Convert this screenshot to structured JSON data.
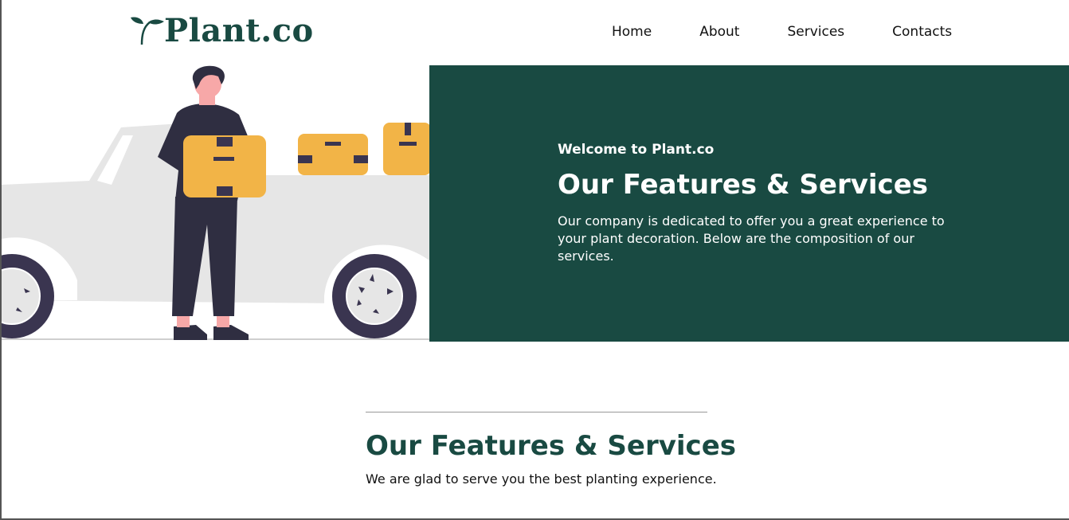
{
  "brand": {
    "name": "Plant.co",
    "color": "#194a42"
  },
  "nav": {
    "items": [
      {
        "label": "Home"
      },
      {
        "label": "About"
      },
      {
        "label": "Services"
      },
      {
        "label": "Contacts"
      }
    ]
  },
  "hero": {
    "kicker": "Welcome to Plant.co",
    "title": "Our Features & Services",
    "description": "Our company is dedicated to offer you a great experience to your plant decoration. Below are the composition of our services.",
    "panel_color": "#194a42",
    "illustration": "delivery-person-with-boxes-and-truck"
  },
  "section": {
    "title": "Our Features & Services",
    "description": "We are glad to serve you the best planting experience."
  }
}
